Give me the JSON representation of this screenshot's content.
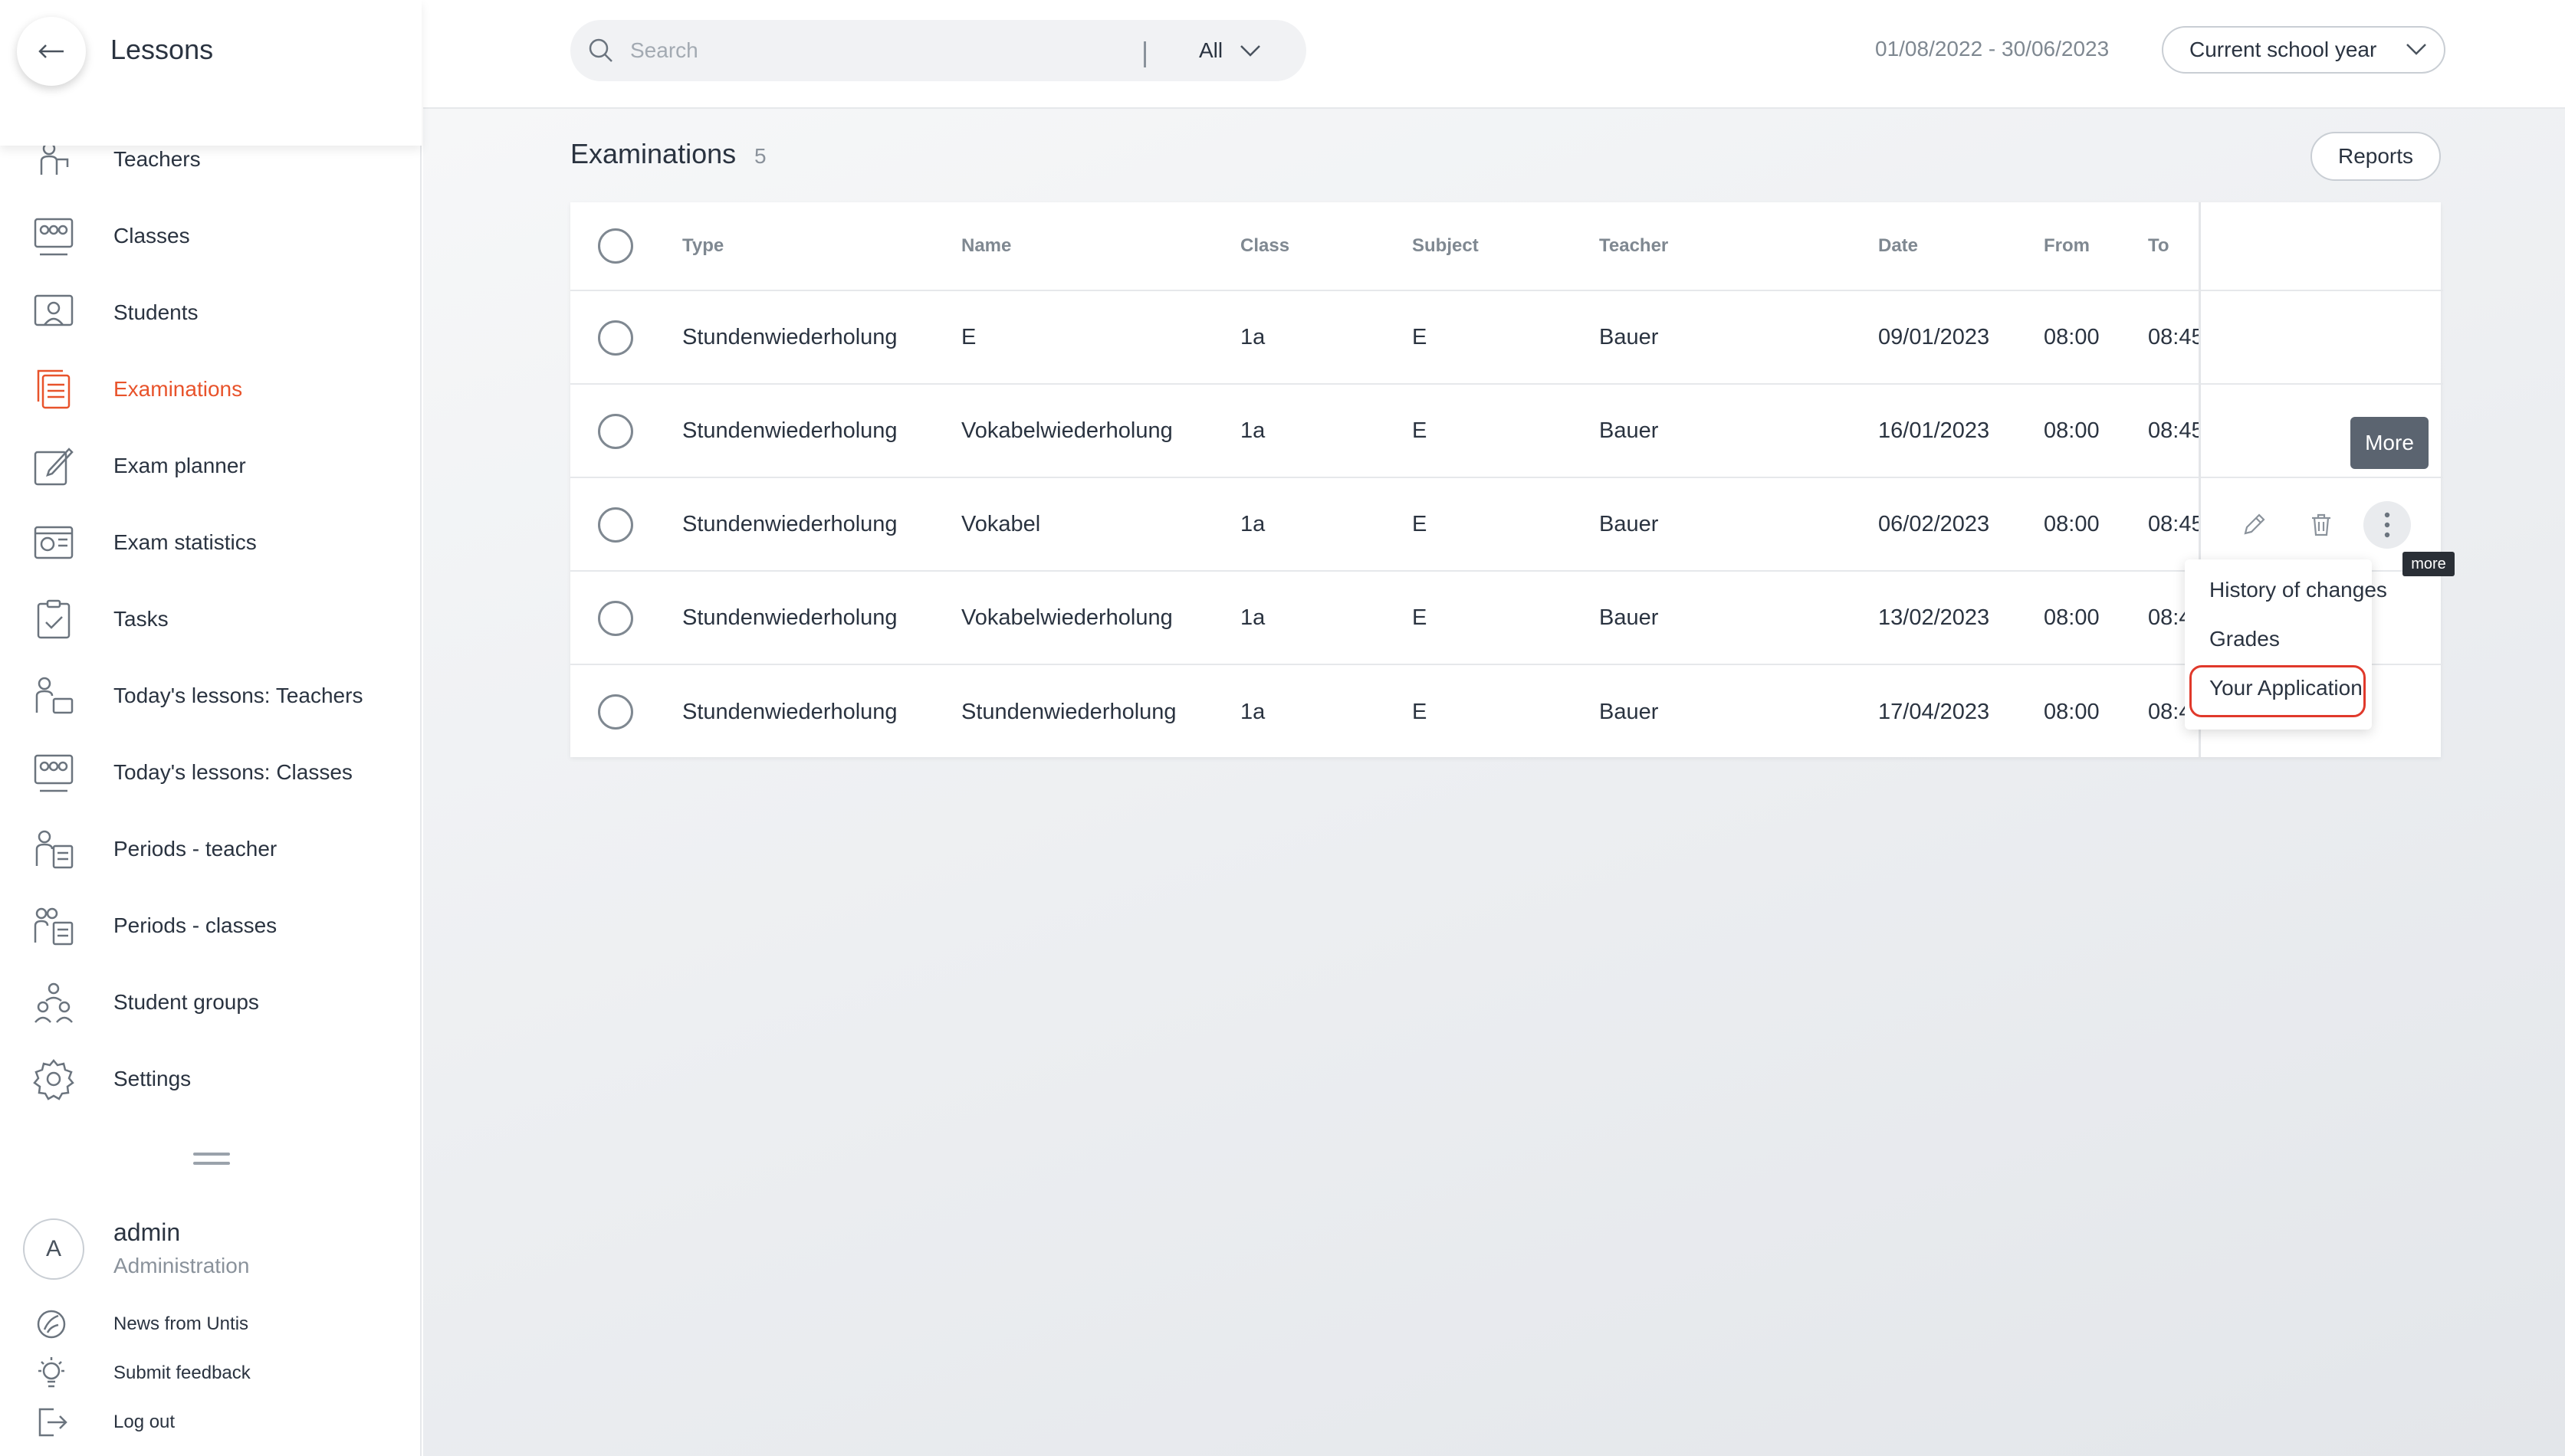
{
  "sidebar": {
    "title": "Lessons",
    "items": [
      {
        "label": "Teachers",
        "icon": "teacher-icon",
        "active": false
      },
      {
        "label": "Classes",
        "icon": "classes-icon",
        "active": false
      },
      {
        "label": "Students",
        "icon": "students-icon",
        "active": false
      },
      {
        "label": "Examinations",
        "icon": "examinations-icon",
        "active": true
      },
      {
        "label": "Exam planner",
        "icon": "exam-planner-icon",
        "active": false
      },
      {
        "label": "Exam statistics",
        "icon": "exam-statistics-icon",
        "active": false
      },
      {
        "label": "Tasks",
        "icon": "tasks-icon",
        "active": false
      },
      {
        "label": "Today's lessons: Teachers",
        "icon": "todays-lessons-teachers-icon",
        "active": false
      },
      {
        "label": "Today's lessons: Classes",
        "icon": "todays-lessons-classes-icon",
        "active": false
      },
      {
        "label": "Periods - teacher",
        "icon": "periods-teacher-icon",
        "active": false
      },
      {
        "label": "Periods - classes",
        "icon": "periods-classes-icon",
        "active": false
      },
      {
        "label": "Student groups",
        "icon": "student-groups-icon",
        "active": false
      },
      {
        "label": "Settings",
        "icon": "settings-icon",
        "active": false
      }
    ],
    "user": {
      "initial": "A",
      "name": "admin",
      "role": "Administration"
    },
    "footer": [
      {
        "label": "News from Untis",
        "icon": "news-icon"
      },
      {
        "label": "Submit feedback",
        "icon": "lightbulb-icon"
      },
      {
        "label": "Log out",
        "icon": "logout-icon"
      }
    ]
  },
  "topbar": {
    "search_placeholder": "Search",
    "filter_value": "All",
    "date_range": "01/08/2022 - 30/06/2023",
    "year_select": "Current school year"
  },
  "page": {
    "title": "Examinations",
    "count": "5",
    "reports_label": "Reports"
  },
  "table": {
    "columns": [
      "Type",
      "Name",
      "Class",
      "Subject",
      "Teacher",
      "Date",
      "From",
      "To"
    ],
    "rows": [
      {
        "type": "Stundenwiederholung",
        "name": "E",
        "class": "1a",
        "subject": "E",
        "teacher": "Bauer",
        "date": "09/01/2023",
        "from": "08:00",
        "to": "08:45"
      },
      {
        "type": "Stundenwiederholung",
        "name": "Vokabelwiederholung",
        "class": "1a",
        "subject": "E",
        "teacher": "Bauer",
        "date": "16/01/2023",
        "from": "08:00",
        "to": "08:45"
      },
      {
        "type": "Stundenwiederholung",
        "name": "Vokabel",
        "class": "1a",
        "subject": "E",
        "teacher": "Bauer",
        "date": "06/02/2023",
        "from": "08:00",
        "to": "08:45"
      },
      {
        "type": "Stundenwiederholung",
        "name": "Vokabelwiederholung",
        "class": "1a",
        "subject": "E",
        "teacher": "Bauer",
        "date": "13/02/2023",
        "from": "08:00",
        "to": "08:4"
      },
      {
        "type": "Stundenwiederholung",
        "name": "Stundenwiederholung",
        "class": "1a",
        "subject": "E",
        "teacher": "Bauer",
        "date": "17/04/2023",
        "from": "08:00",
        "to": "08:4"
      }
    ]
  },
  "tooltips": {
    "more_large": "More",
    "more_small": "more"
  },
  "more_menu": {
    "items": [
      "History of changes",
      "Grades",
      "Your Application"
    ],
    "highlighted": "Your Application"
  },
  "colors": {
    "accent": "#e8532b",
    "highlight_border": "#e0392b"
  }
}
